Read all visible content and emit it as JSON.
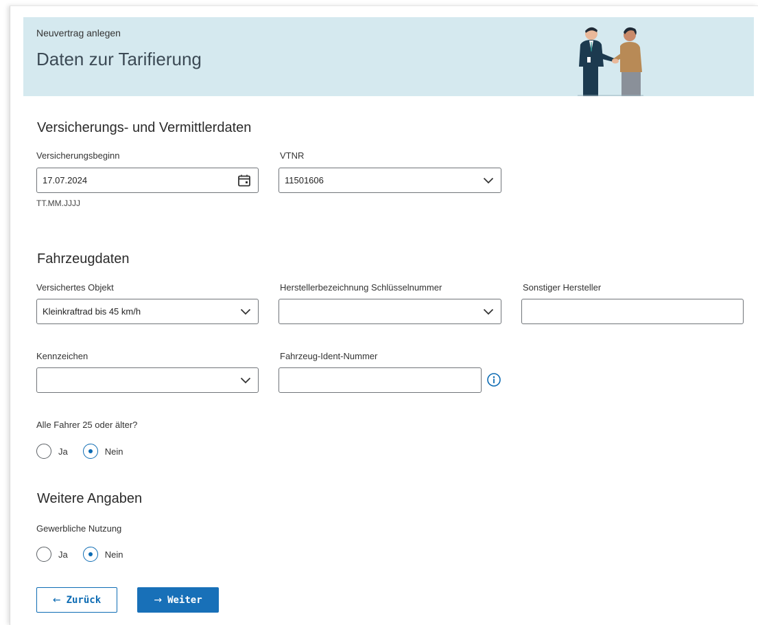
{
  "banner": {
    "subtitle": "Neuvertrag anlegen",
    "title": "Daten zur Tarifierung"
  },
  "section_insurance": {
    "heading": "Versicherungs- und Vermittlerdaten",
    "start_label": "Versicherungsbeginn",
    "start_value": "17.07.2024",
    "start_hint": "TT.MM.JJJJ",
    "vtnr_label": "VTNR",
    "vtnr_value": "11501606"
  },
  "section_vehicle": {
    "heading": "Fahrzeugdaten",
    "object_label": "Versichertes Objekt",
    "object_value": "Kleinkraftrad bis 45 km/h",
    "manufacturer_label": "Herstellerbezeichnung Schlüsselnummer",
    "manufacturer_value": "",
    "other_manufacturer_label": "Sonstiger Hersteller",
    "other_manufacturer_value": "",
    "plate_label": "Kennzeichen",
    "plate_value": "",
    "vin_label": "Fahrzeug-Ident-Nummer",
    "vin_value": "",
    "drivers_question": "Alle Fahrer 25 oder älter?",
    "drivers_yes": "Ja",
    "drivers_no": "Nein",
    "drivers_selected": "Nein"
  },
  "section_more": {
    "heading": "Weitere Angaben",
    "commercial_question": "Gewerbliche Nutzung",
    "commercial_yes": "Ja",
    "commercial_no": "Nein",
    "commercial_selected": "Nein"
  },
  "buttons": {
    "back_label": "Zurück",
    "next_label": "Weiter"
  },
  "colors": {
    "banner_bg": "#d5e9ef",
    "accent": "#0c6bb3",
    "primary_button": "#1870b8"
  }
}
